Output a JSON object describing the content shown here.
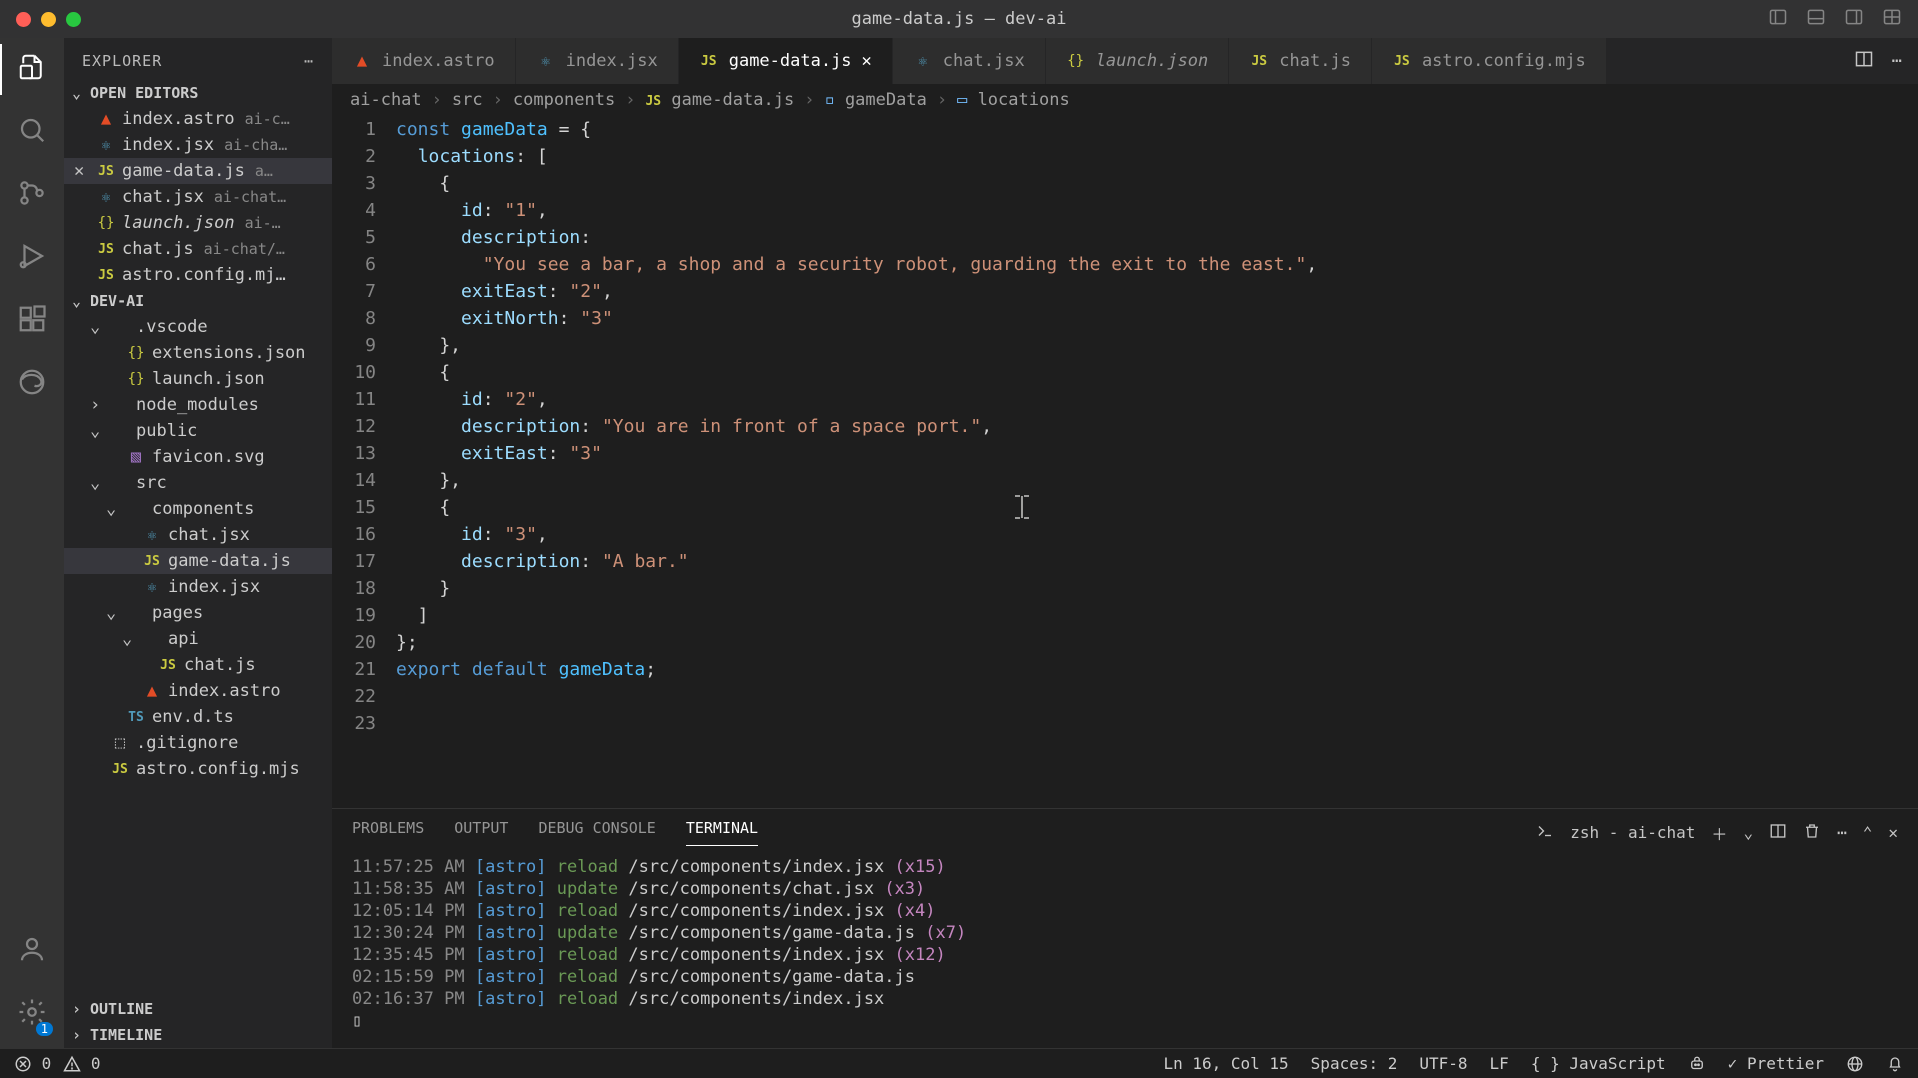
{
  "window": {
    "title": "game-data.js — dev-ai"
  },
  "explorer": {
    "title": "EXPLORER",
    "open_editors_label": "OPEN EDITORS",
    "outline_label": "OUTLINE",
    "timeline_label": "TIMELINE",
    "project_label": "DEV-AI",
    "open_editors": [
      {
        "name": "index.astro",
        "hint": "ai-c…",
        "icon": "astro"
      },
      {
        "name": "index.jsx",
        "hint": "ai-cha…",
        "icon": "jsx"
      },
      {
        "name": "game-data.js",
        "hint": "a…",
        "icon": "js",
        "active": true,
        "close": true
      },
      {
        "name": "chat.jsx",
        "hint": "ai-chat…",
        "icon": "jsx"
      },
      {
        "name": "launch.json",
        "hint": "ai-…",
        "icon": "json",
        "italic": true
      },
      {
        "name": "chat.js",
        "hint": "ai-chat/…",
        "icon": "js"
      },
      {
        "name": "astro.config.mj…",
        "hint": "",
        "icon": "js"
      }
    ],
    "tree": [
      {
        "indent": 1,
        "chev": "down",
        "name": ".vscode",
        "type": "folder"
      },
      {
        "indent": 2,
        "name": "extensions.json",
        "type": "json"
      },
      {
        "indent": 2,
        "name": "launch.json",
        "type": "json"
      },
      {
        "indent": 1,
        "chev": "right",
        "name": "node_modules",
        "type": "folder"
      },
      {
        "indent": 1,
        "chev": "down",
        "name": "public",
        "type": "folder"
      },
      {
        "indent": 2,
        "name": "favicon.svg",
        "type": "svg"
      },
      {
        "indent": 1,
        "chev": "down",
        "name": "src",
        "type": "folder"
      },
      {
        "indent": 2,
        "chev": "down",
        "name": "components",
        "type": "folder"
      },
      {
        "indent": 3,
        "name": "chat.jsx",
        "type": "jsx"
      },
      {
        "indent": 3,
        "name": "game-data.js",
        "type": "js",
        "active": true
      },
      {
        "indent": 3,
        "name": "index.jsx",
        "type": "jsx"
      },
      {
        "indent": 2,
        "chev": "down",
        "name": "pages",
        "type": "folder"
      },
      {
        "indent": 3,
        "chev": "down",
        "name": "api",
        "type": "folder"
      },
      {
        "indent": 4,
        "name": "chat.js",
        "type": "js"
      },
      {
        "indent": 3,
        "name": "index.astro",
        "type": "astro"
      },
      {
        "indent": 2,
        "name": "env.d.ts",
        "type": "ts"
      },
      {
        "indent": 1,
        "name": ".gitignore",
        "type": "file"
      },
      {
        "indent": 1,
        "name": "astro.config.mjs",
        "type": "js"
      }
    ]
  },
  "tabs": [
    {
      "name": "index.astro",
      "icon": "astro"
    },
    {
      "name": "index.jsx",
      "icon": "jsx"
    },
    {
      "name": "game-data.js",
      "icon": "js",
      "active": true,
      "close": true
    },
    {
      "name": "chat.jsx",
      "icon": "jsx"
    },
    {
      "name": "launch.json",
      "icon": "json",
      "italic": true
    },
    {
      "name": "chat.js",
      "icon": "js"
    },
    {
      "name": "astro.config.mjs",
      "icon": "js"
    }
  ],
  "breadcrumb": [
    "ai-chat",
    "src",
    "components",
    "game-data.js",
    "gameData",
    "locations"
  ],
  "panel": {
    "tabs": [
      "PROBLEMS",
      "OUTPUT",
      "DEBUG CONSOLE",
      "TERMINAL"
    ],
    "active_tab": "TERMINAL",
    "terminal_label": "zsh - ai-chat",
    "lines": [
      {
        "time": "11:57:25 AM",
        "src": "[astro]",
        "act": "reload",
        "path": "/src/components/index.jsx",
        "count": "(x15)"
      },
      {
        "time": "11:58:35 AM",
        "src": "[astro]",
        "act": "update",
        "path": "/src/components/chat.jsx",
        "count": "(x3)"
      },
      {
        "time": "12:05:14 PM",
        "src": "[astro]",
        "act": "reload",
        "path": "/src/components/index.jsx",
        "count": "(x4)"
      },
      {
        "time": "12:30:24 PM",
        "src": "[astro]",
        "act": "update",
        "path": "/src/components/game-data.js",
        "count": "(x7)"
      },
      {
        "time": "12:35:45 PM",
        "src": "[astro]",
        "act": "reload",
        "path": "/src/components/index.jsx",
        "count": "(x12)"
      },
      {
        "time": "02:15:59 PM",
        "src": "[astro]",
        "act": "reload",
        "path": "/src/components/game-data.js",
        "count": ""
      },
      {
        "time": "02:16:37 PM",
        "src": "[astro]",
        "act": "reload",
        "path": "/src/components/index.jsx",
        "count": ""
      }
    ]
  },
  "statusbar": {
    "errors": "0",
    "warnings": "0",
    "position": "Ln 16, Col 15",
    "spaces": "Spaces: 2",
    "encoding": "UTF-8",
    "eol": "LF",
    "language": "JavaScript",
    "prettier": "Prettier"
  },
  "code": {
    "lines": [
      [
        [
          "kw",
          "const "
        ],
        [
          "var",
          "gameData"
        ],
        [
          "punc",
          " = {"
        ]
      ],
      [
        [
          "punc",
          "  "
        ],
        [
          "prop",
          "locations"
        ],
        [
          "punc",
          ": ["
        ]
      ],
      [
        [
          "punc",
          "    {"
        ]
      ],
      [
        [
          "punc",
          "      "
        ],
        [
          "prop",
          "id"
        ],
        [
          "punc",
          ": "
        ],
        [
          "str",
          "\"1\""
        ],
        [
          "punc",
          ","
        ]
      ],
      [
        [
          "punc",
          "      "
        ],
        [
          "prop",
          "description"
        ],
        [
          "punc",
          ":"
        ]
      ],
      [
        [
          "punc",
          "        "
        ],
        [
          "str",
          "\"You see a bar, a shop and a security robot, guarding the exit to the east.\""
        ],
        [
          "punc",
          ","
        ]
      ],
      [
        [
          "punc",
          "      "
        ],
        [
          "prop",
          "exitEast"
        ],
        [
          "punc",
          ": "
        ],
        [
          "str",
          "\"2\""
        ],
        [
          "punc",
          ","
        ]
      ],
      [
        [
          "punc",
          "      "
        ],
        [
          "prop",
          "exitNorth"
        ],
        [
          "punc",
          ": "
        ],
        [
          "str",
          "\"3\""
        ]
      ],
      [
        [
          "punc",
          "    },"
        ]
      ],
      [
        [
          "punc",
          "    {"
        ]
      ],
      [
        [
          "punc",
          "      "
        ],
        [
          "prop",
          "id"
        ],
        [
          "punc",
          ": "
        ],
        [
          "str",
          "\"2\""
        ],
        [
          "punc",
          ","
        ]
      ],
      [
        [
          "punc",
          "      "
        ],
        [
          "prop",
          "description"
        ],
        [
          "punc",
          ": "
        ],
        [
          "str",
          "\"You are in front of a space port.\""
        ],
        [
          "punc",
          ","
        ]
      ],
      [
        [
          "punc",
          "      "
        ],
        [
          "prop",
          "exitEast"
        ],
        [
          "punc",
          ": "
        ],
        [
          "str",
          "\"3\""
        ]
      ],
      [
        [
          "punc",
          "    },"
        ]
      ],
      [
        [
          "punc",
          "    {"
        ]
      ],
      [
        [
          "punc",
          "      "
        ],
        [
          "prop",
          "id"
        ],
        [
          "punc",
          ": "
        ],
        [
          "str",
          "\"3\""
        ],
        [
          "punc",
          ","
        ]
      ],
      [
        [
          "punc",
          "      "
        ],
        [
          "prop",
          "description"
        ],
        [
          "punc",
          ": "
        ],
        [
          "str",
          "\"A bar.\""
        ]
      ],
      [
        [
          "punc",
          "    }"
        ]
      ],
      [
        [
          "punc",
          "  ]"
        ]
      ],
      [
        [
          "punc",
          "};"
        ]
      ],
      [
        [
          "punc",
          ""
        ]
      ],
      [
        [
          "kw",
          "export default "
        ],
        [
          "var",
          "gameData"
        ],
        [
          "punc",
          ";"
        ]
      ],
      [
        [
          "punc",
          ""
        ]
      ]
    ]
  }
}
